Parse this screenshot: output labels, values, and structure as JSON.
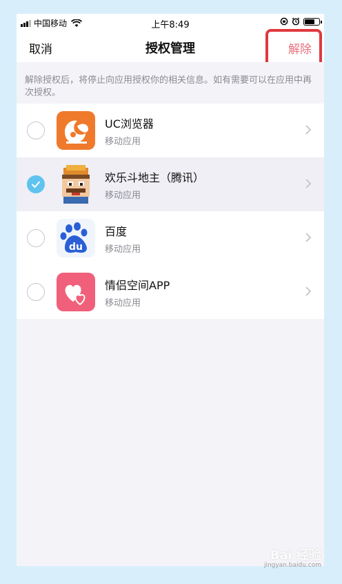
{
  "status_bar": {
    "carrier": "中国移动",
    "time": "上午8:49",
    "battery_level": 0.75
  },
  "nav": {
    "cancel_label": "取消",
    "title": "授权管理",
    "release_label": "解除"
  },
  "notice": {
    "text": "解除授权后，将停止向应用授权你的相关信息。如有需要可以在应用中再次授权。"
  },
  "apps": [
    {
      "name": "UC浏览器",
      "subtitle": "移动应用",
      "selected": false,
      "icon": "uc-browser-icon"
    },
    {
      "name": "欢乐斗地主（腾讯）",
      "subtitle": "移动应用",
      "selected": true,
      "icon": "doudizhu-icon"
    },
    {
      "name": "百度",
      "subtitle": "移动应用",
      "selected": false,
      "icon": "baidu-icon"
    },
    {
      "name": "情侣空间APP",
      "subtitle": "移动应用",
      "selected": false,
      "icon": "couple-space-icon"
    }
  ],
  "colors": {
    "accent_red": "#e8707d",
    "check_blue": "#5fc3ef",
    "highlight": "#e0383f"
  },
  "watermark": {
    "text": "Bai 经验",
    "sub": "jingyan.baidu.com"
  }
}
